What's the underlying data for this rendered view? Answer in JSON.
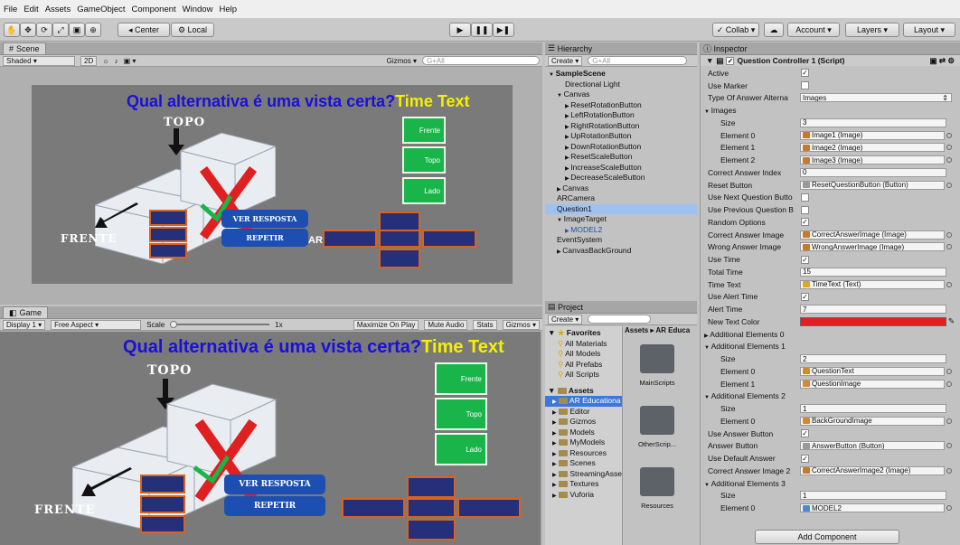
{
  "menu": [
    "File",
    "Edit",
    "Assets",
    "GameObject",
    "Component",
    "Window",
    "Help"
  ],
  "toolbar": {
    "center": "Center",
    "local": "Local",
    "collab": "Collab",
    "account": "Account",
    "layers": "Layers",
    "layout": "Layout"
  },
  "scene": {
    "tab": "Scene",
    "shading": "Shaded",
    "mode2d": "2D",
    "gizmos": "Gizmos",
    "search_placeholder": "G+All"
  },
  "game": {
    "tab": "Game",
    "display": "Display 1",
    "aspect": "Free Aspect",
    "scale_label": "Scale",
    "scale_value": "1x",
    "maximize": "Maximize On Play",
    "mute": "Mute Audio",
    "stats": "Stats",
    "gizmos": "Gizmos"
  },
  "view": {
    "question": "Qual alternativa é uma vista certa?",
    "time_text": "Time Text",
    "topo": "TOPO",
    "frente": "FRENTE",
    "ver_resposta": "VER RESPOSTA",
    "repetir": "REPETIR",
    "opt_frente": "Frente",
    "opt_topo": "Topo",
    "opt_lado": "Lado",
    "ar_fragment": "AR"
  },
  "hierarchy": {
    "title": "Hierarchy",
    "create": "Create",
    "search_placeholder": "G+All",
    "items": [
      {
        "label": "SampleScene",
        "indent": 0,
        "bold": true,
        "arrow": "▼"
      },
      {
        "label": "Directional Light",
        "indent": 2,
        "arrow": ""
      },
      {
        "label": "Canvas",
        "indent": 1,
        "arrow": "▼"
      },
      {
        "label": "ResetRotationButton",
        "indent": 2,
        "arrow": "▶"
      },
      {
        "label": "LeftRotationButton",
        "indent": 2,
        "arrow": "▶"
      },
      {
        "label": "RightRotationButton",
        "indent": 2,
        "arrow": "▶"
      },
      {
        "label": "UpRotationButton",
        "indent": 2,
        "arrow": "▶"
      },
      {
        "label": "DownRotationButton",
        "indent": 2,
        "arrow": "▶"
      },
      {
        "label": "ResetScaleButton",
        "indent": 2,
        "arrow": "▶"
      },
      {
        "label": "IncreaseScaleButton",
        "indent": 2,
        "arrow": "▶"
      },
      {
        "label": "DecreaseScaleButton",
        "indent": 2,
        "arrow": "▶"
      },
      {
        "label": "Canvas",
        "indent": 1,
        "arrow": "▶"
      },
      {
        "label": "ARCamera",
        "indent": 1,
        "arrow": ""
      },
      {
        "label": "Question1",
        "indent": 1,
        "arrow": "",
        "selected": true
      },
      {
        "label": "ImageTarget",
        "indent": 1,
        "arrow": "▼"
      },
      {
        "label": "MODEL2",
        "indent": 2,
        "arrow": "▶",
        "blue": true
      },
      {
        "label": "EventSystem",
        "indent": 1,
        "arrow": ""
      },
      {
        "label": "CanvasBackGround",
        "indent": 1,
        "arrow": "▶"
      }
    ]
  },
  "project": {
    "title": "Project",
    "create": "Create",
    "breadcrumb": "Assets ▸ AR Educa",
    "favorites_label": "Favorites",
    "favorites": [
      "All Materials",
      "All Models",
      "All Prefabs",
      "All Scripts"
    ],
    "assets_label": "Assets",
    "assets": [
      "AR Educationa",
      "Editor",
      "Gizmos",
      "Models",
      "MyModels",
      "Resources",
      "Scenes",
      "StreamingAsse",
      "Textures",
      "Vuforia"
    ],
    "folders": [
      "MainScripts",
      "OtherScrip...",
      "Resources"
    ]
  },
  "inspector": {
    "title": "Inspector",
    "component": "Question Controller 1 (Script)",
    "add_component": "Add Component",
    "rows": [
      {
        "label": "Active",
        "kind": "check",
        "value": "✓"
      },
      {
        "label": "Use Marker",
        "kind": "check",
        "value": ""
      },
      {
        "label": "Type Of Answer Alterna",
        "kind": "select",
        "value": "Images"
      },
      {
        "label": "Images",
        "kind": "fold",
        "value": ""
      },
      {
        "label": "Size",
        "kind": "text",
        "value": "3",
        "indent": 1
      },
      {
        "label": "Element 0",
        "kind": "ref",
        "value": "Image1 (Image)",
        "indent": 1,
        "icon": "image"
      },
      {
        "label": "Element 1",
        "kind": "ref",
        "value": "Image2 (Image)",
        "indent": 1,
        "icon": "image"
      },
      {
        "label": "Element 2",
        "kind": "ref",
        "value": "Image3 (Image)",
        "indent": 1,
        "icon": "image"
      },
      {
        "label": "Correct Answer Index",
        "kind": "text",
        "value": "0"
      },
      {
        "label": "Reset Button",
        "kind": "ref",
        "value": "ResetQuestionButton (Button)",
        "icon": "button"
      },
      {
        "label": "Use Next Question Butto",
        "kind": "check",
        "value": ""
      },
      {
        "label": "Use Previous Question B",
        "kind": "check",
        "value": ""
      },
      {
        "label": "Random Options",
        "kind": "check",
        "value": "✓"
      },
      {
        "label": "Correct Answer Image",
        "kind": "ref",
        "value": "CorrectAnswerImage (Image)",
        "icon": "image"
      },
      {
        "label": "Wrong Answer Image",
        "kind": "ref",
        "value": "WrongAnswerImage (Image)",
        "icon": "image"
      },
      {
        "label": "Use Time",
        "kind": "check",
        "value": "✓"
      },
      {
        "label": "Total Time",
        "kind": "text",
        "value": "15"
      },
      {
        "label": "Time Text",
        "kind": "ref",
        "value": "TimeText (Text)",
        "icon": "text"
      },
      {
        "label": "Use Alert Time",
        "kind": "check",
        "value": "✓"
      },
      {
        "label": "Alert Time",
        "kind": "text",
        "value": "7"
      },
      {
        "label": "New Text Color",
        "kind": "color",
        "value": ""
      },
      {
        "label": "Additional Elements 0",
        "kind": "fold",
        "value": "",
        "closed": true
      },
      {
        "label": "Additional Elements 1",
        "kind": "fold",
        "value": ""
      },
      {
        "label": "Size",
        "kind": "text",
        "value": "2",
        "indent": 1
      },
      {
        "label": "Element 0",
        "kind": "ref",
        "value": "QuestionText",
        "indent": 1,
        "icon": "go"
      },
      {
        "label": "Element 1",
        "kind": "ref",
        "value": "QuestionImage",
        "indent": 1,
        "icon": "go"
      },
      {
        "label": "Additional Elements 2",
        "kind": "fold",
        "value": ""
      },
      {
        "label": "Size",
        "kind": "text",
        "value": "1",
        "indent": 1
      },
      {
        "label": "Element 0",
        "kind": "ref",
        "value": "BackGroundImage",
        "indent": 1,
        "icon": "go"
      },
      {
        "label": "Use Answer Button",
        "kind": "check",
        "value": "✓"
      },
      {
        "label": "Answer Button",
        "kind": "ref",
        "value": "AnswerButton (Button)",
        "icon": "button"
      },
      {
        "label": "Use Default Answer",
        "kind": "check",
        "value": "✓"
      },
      {
        "label": "Correct Answer Image 2",
        "kind": "ref",
        "value": "CorrectAnswerImage2 (Image)",
        "icon": "image"
      },
      {
        "label": "Additional Elements 3",
        "kind": "fold",
        "value": ""
      },
      {
        "label": "Size",
        "kind": "text",
        "value": "1",
        "indent": 1
      },
      {
        "label": "Element 0",
        "kind": "ref",
        "value": "MODEL2",
        "indent": 1,
        "icon": "model"
      }
    ]
  },
  "colors": {
    "accent_blue": "#1a10d8",
    "yellow": "#f4f000",
    "green": "#19b54a",
    "red": "#e02020",
    "selected": "#9ec1ef"
  }
}
